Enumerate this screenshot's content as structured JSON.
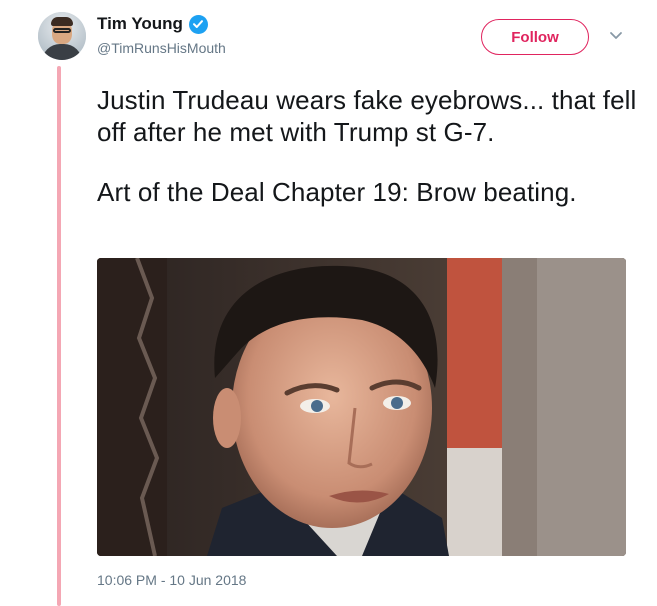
{
  "tweet": {
    "author": {
      "display_name": "Tim Young",
      "handle": "@TimRunsHisMouth",
      "verified": true,
      "avatar_icon": "user-avatar"
    },
    "follow_label": "Follow",
    "menu_icon": "chevron-down-icon",
    "text_paragraphs": [
      "Justin Trudeau wears fake eyebrows... that fell off after he met with Trump st G-7.",
      "Art of the Deal Chapter 19: Brow beating."
    ],
    "media_icon": "photo-of-man-face",
    "timestamp": "10:06 PM - 10 Jun 2018"
  },
  "colors": {
    "follow_accent": "#e0245e",
    "verified_badge": "#1da1f2",
    "thread_line": "#f4a7b4",
    "secondary_text": "#657786"
  }
}
